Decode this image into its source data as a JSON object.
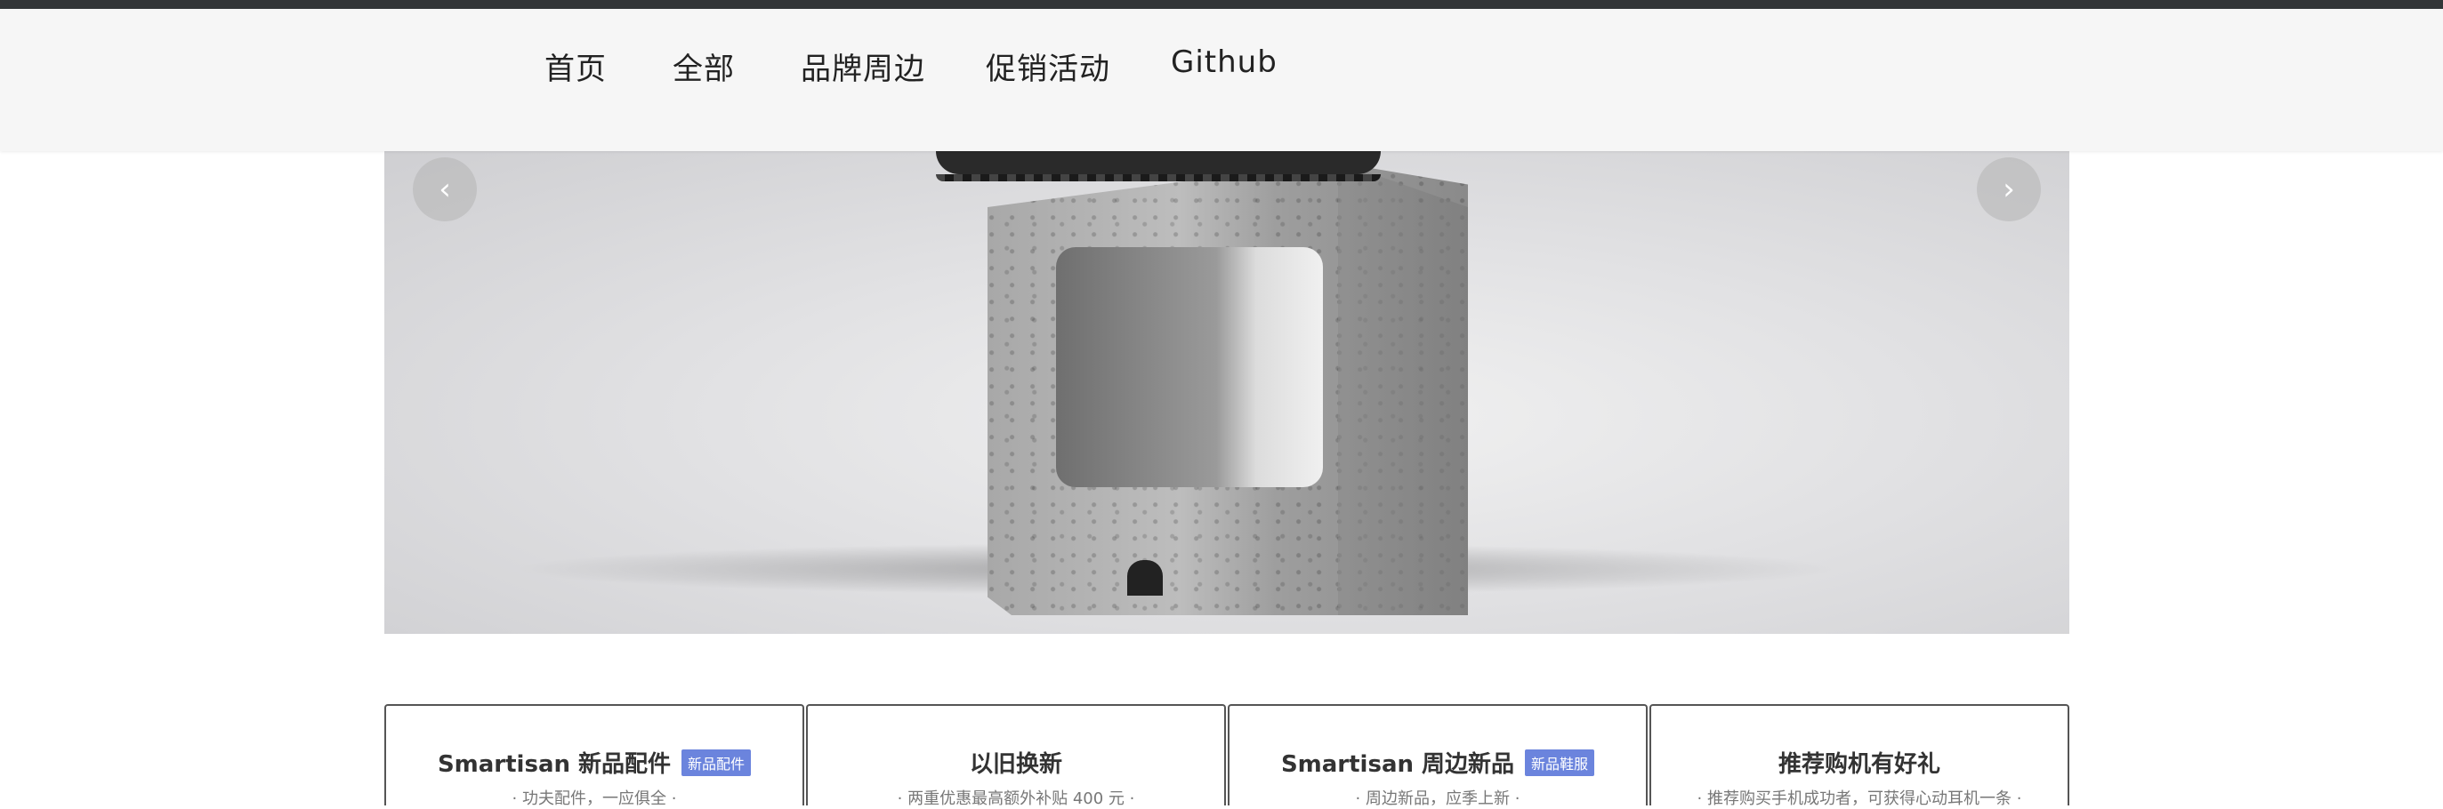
{
  "nav": {
    "items": [
      {
        "label": "首页"
      },
      {
        "label": "全部"
      },
      {
        "label": "品牌周边"
      },
      {
        "label": "促销活动"
      },
      {
        "label": "Github"
      }
    ]
  },
  "carousel": {
    "prev_icon": "‹",
    "next_icon": "›",
    "image_subject": "shoe-on-concrete-block"
  },
  "cards": [
    {
      "title": "Smartisan 新品配件",
      "badge": "新品配件",
      "subtitle": "· 功夫配件，一应俱全 ·"
    },
    {
      "title": "以旧换新",
      "badge": "",
      "subtitle": "· 两重优惠最高额外补贴 400 元 ·"
    },
    {
      "title": "Smartisan 周边新品",
      "badge": "新品鞋服",
      "subtitle": "· 周边新品，应季上新 ·"
    },
    {
      "title": "推荐购机有好礼",
      "badge": "",
      "subtitle": "· 推荐购买手机成功者，可获得心动耳机一条 ·"
    }
  ],
  "colors": {
    "topbar": "#333638",
    "nav_bg": "#f6f6f6",
    "badge": "#6b84dd"
  }
}
